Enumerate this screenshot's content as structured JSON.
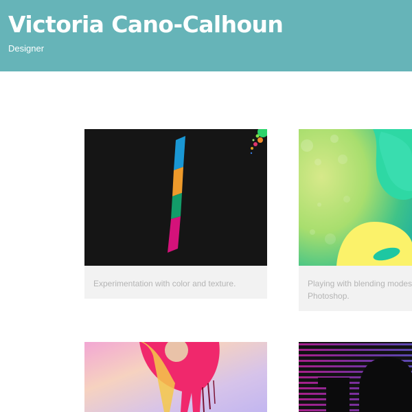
{
  "header": {
    "title": "Victoria Cano-Calhoun",
    "subtitle": "Designer",
    "background_color": "#66b4b8"
  },
  "portfolio": {
    "items": [
      {
        "caption": "Experimentation with color and texture."
      },
      {
        "caption": "Playing with blending modes in Photoshop."
      },
      {
        "caption": ""
      },
      {
        "caption": ""
      }
    ]
  }
}
